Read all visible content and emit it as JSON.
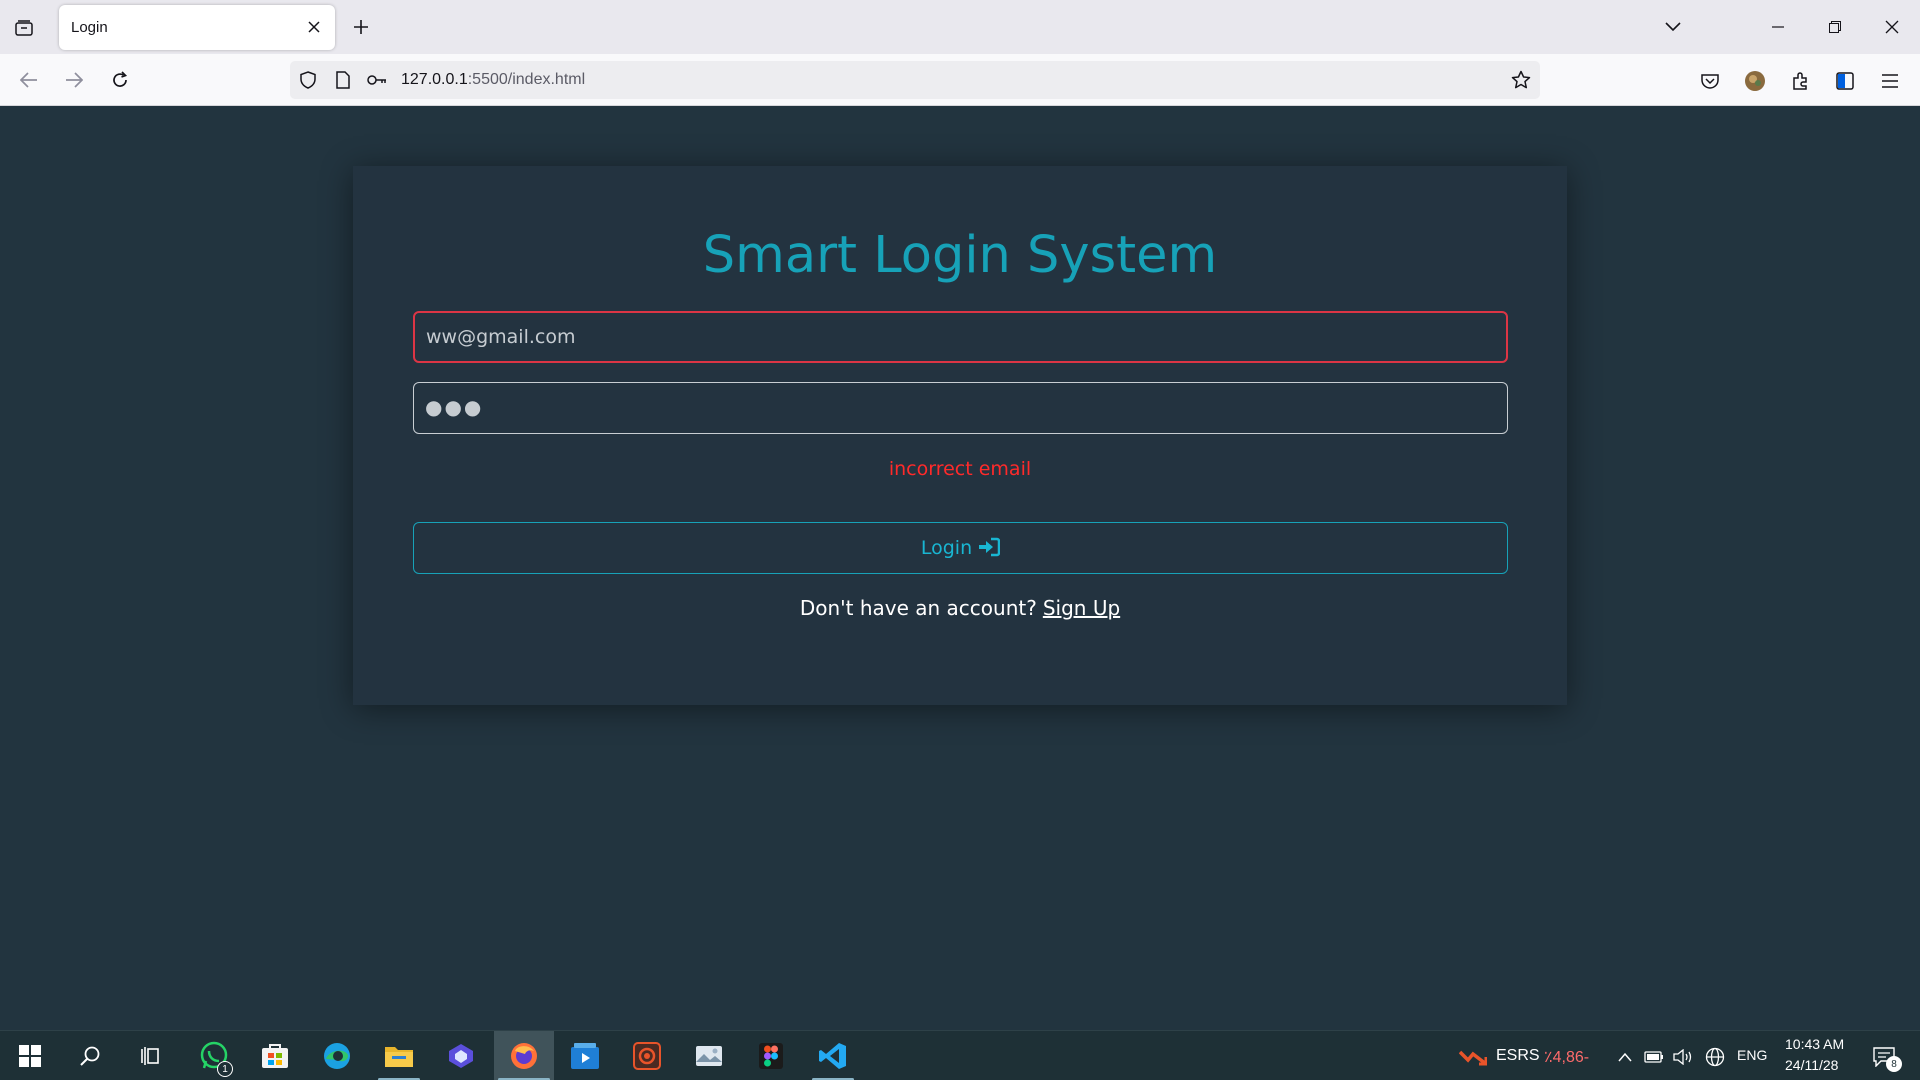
{
  "browser": {
    "tab": {
      "title": "Login"
    },
    "url": {
      "host": "127.0.0.1",
      "path": ":5500/index.html"
    },
    "icons": {
      "tab_list": "tab-list-icon",
      "close": "close-icon",
      "new_tab": "plus-icon",
      "overflow": "chevron-down-icon",
      "back": "back-arrow-icon",
      "forward": "forward-arrow-icon",
      "reload": "reload-icon",
      "shield": "shield-icon",
      "page": "page-icon",
      "key": "key-icon",
      "bookmark": "star-icon",
      "pocket": "pocket-icon",
      "account": "account-avatar-icon",
      "extensions": "extensions-icon",
      "sidebar": "sidebar-icon",
      "menu": "hamburger-menu-icon"
    }
  },
  "login": {
    "title": "Smart Login System",
    "email_value": "ww@gmail.com",
    "password_mask": "●●●",
    "error": "incorrect email",
    "button_label": "Login",
    "signup_prompt": "Don't have an account?",
    "signup_link": "Sign Up",
    "colors": {
      "accent": "#17a2b8",
      "error": "#ff2a2a",
      "error_border": "#dc3545",
      "card": "#233340",
      "page": "#22343f"
    }
  },
  "taskbar": {
    "apps": [
      {
        "name": "start",
        "icon": "windows-start-icon"
      },
      {
        "name": "search",
        "icon": "search-icon"
      },
      {
        "name": "task-view",
        "icon": "task-view-icon"
      },
      {
        "name": "whatsapp",
        "icon": "whatsapp-icon",
        "badge": "1"
      },
      {
        "name": "store",
        "icon": "microsoft-store-icon"
      },
      {
        "name": "edge",
        "icon": "edge-icon"
      },
      {
        "name": "file-explorer",
        "icon": "folder-icon"
      },
      {
        "name": "copilot",
        "icon": "copilot-icon"
      },
      {
        "name": "firefox",
        "icon": "firefox-icon"
      },
      {
        "name": "media-player",
        "icon": "media-player-icon"
      },
      {
        "name": "screen-recorder",
        "icon": "record-icon"
      },
      {
        "name": "photos",
        "icon": "photos-icon"
      },
      {
        "name": "figma",
        "icon": "figma-icon"
      },
      {
        "name": "vscode",
        "icon": "vscode-icon"
      }
    ],
    "stock": {
      "symbol": "ESRS",
      "change": "٪4,86-"
    },
    "tray": {
      "language": "ENG",
      "time": "10:43 AM",
      "date": "24/11/28",
      "notifications": "8"
    }
  }
}
